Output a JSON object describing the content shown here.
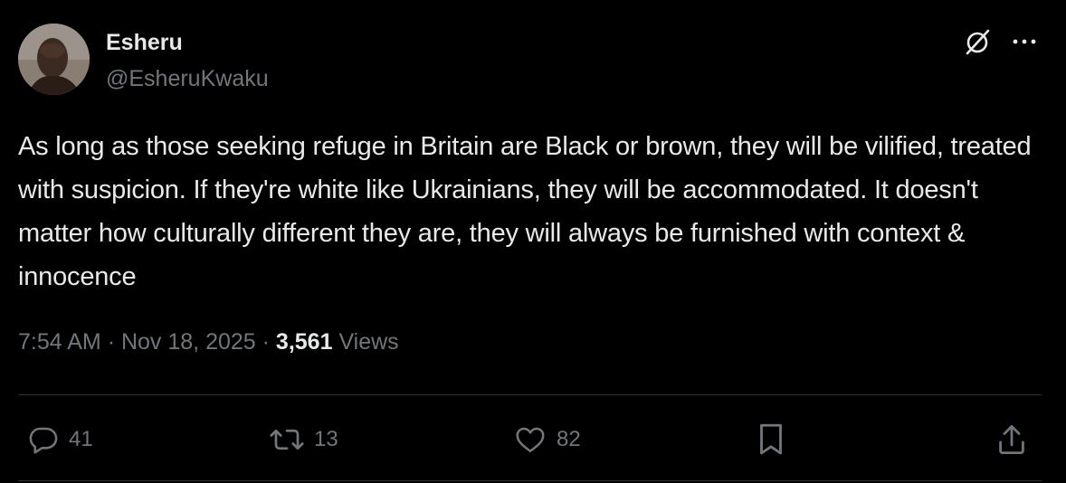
{
  "author": {
    "display_name": "Esheru",
    "handle": "@EsheruKwaku"
  },
  "tweet": {
    "text": "As long as those seeking refuge in Britain are Black or brown, they will be vilified, treated with suspicion. If they're white like Ukrainians, they will be accommodated. It doesn't matter how culturally different they are, they will always be furnished with context & innocence"
  },
  "meta": {
    "time": "7:54 AM",
    "separator": "·",
    "date": "Nov 18, 2025",
    "views_count": "3,561",
    "views_label": "Views"
  },
  "actions": {
    "replies": "41",
    "reposts": "13",
    "likes": "82"
  },
  "icons": {
    "top_right": [
      "grok-icon",
      "more-icon"
    ],
    "action_bar": [
      "reply-icon",
      "repost-icon",
      "like-icon",
      "bookmark-icon",
      "share-icon"
    ]
  },
  "colors": {
    "background": "#000000",
    "primary_text": "#e7e9ea",
    "secondary_text": "#71767b",
    "divider": "#2f3336"
  }
}
